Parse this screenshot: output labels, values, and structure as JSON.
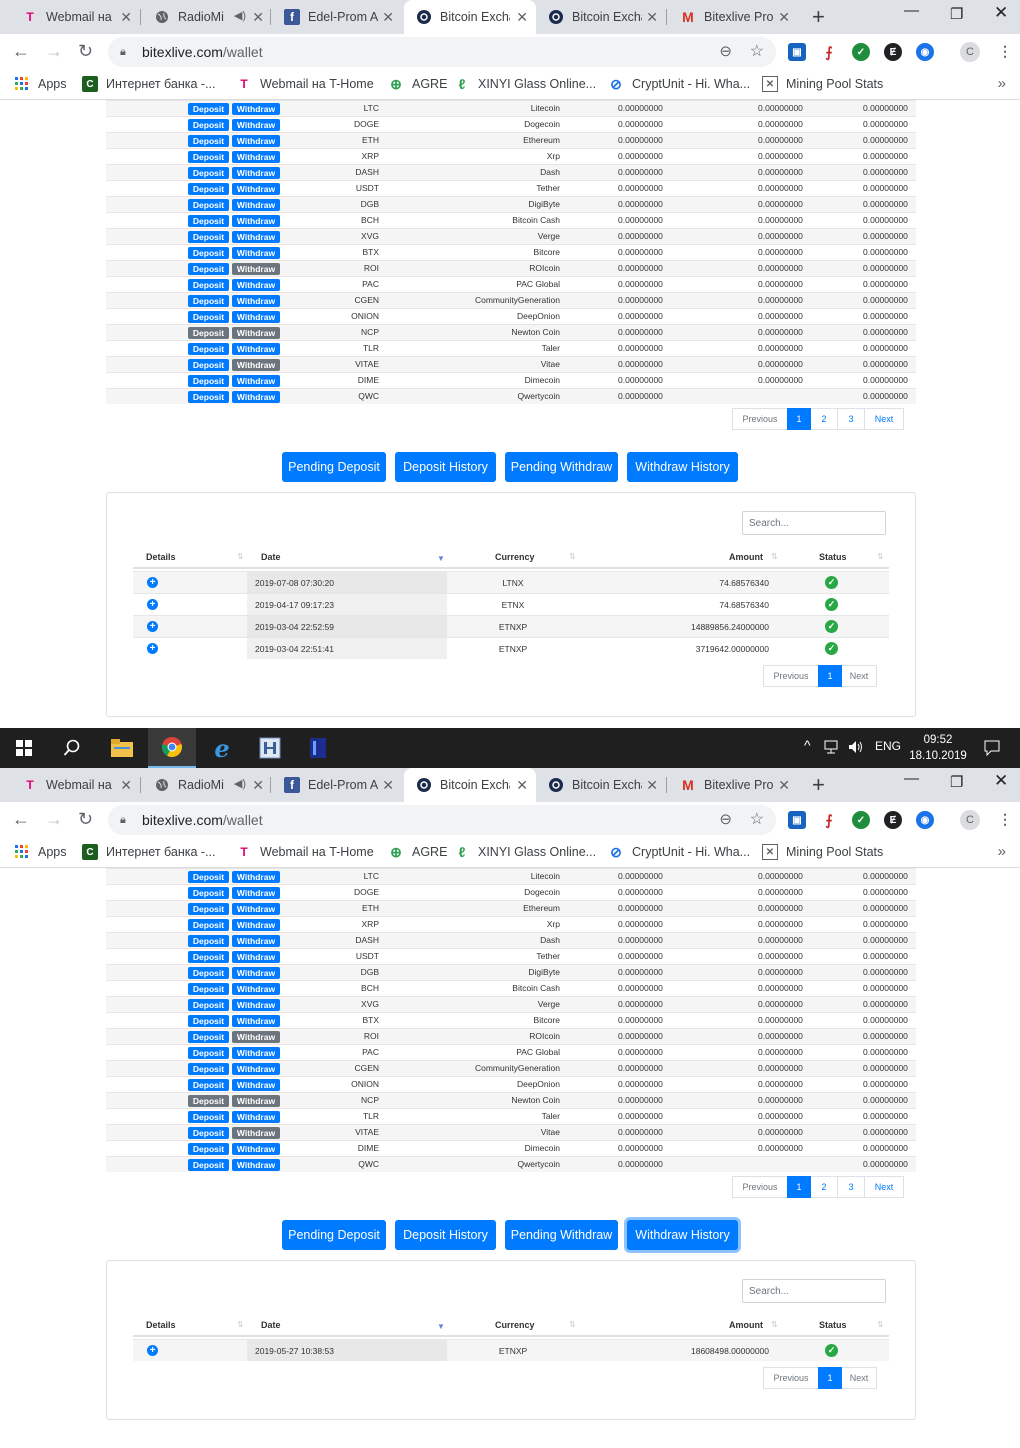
{
  "browser": {
    "tabs": [
      "Webmail на",
      "RadioMi",
      "Edel-Prom A",
      "Bitcoin Excha",
      "Bitcoin Excha",
      "Bitexlive Pro"
    ],
    "tab_icons": [
      "t-home-icon",
      "globe-icon",
      "facebook-icon",
      "bitexlive-icon",
      "bitexlive-icon",
      "gmail-icon"
    ],
    "active_tab": 3,
    "url_host": "bitexlive.com",
    "url_path": "/wallet",
    "bookmarks": [
      "Apps",
      "Интернет банка -...",
      "Webmail на T-Home",
      "AGRE",
      "XINYI Glass Online...",
      "CryptUnit - Hi. Wha...",
      "Mining Pool Stats"
    ]
  },
  "wallet": {
    "deposit_label": "Deposit",
    "withdraw_label": "Withdraw",
    "rows": [
      {
        "symbol": "LTC",
        "name": "Litecoin",
        "available": "0.00000000",
        "on_hold": "0.00000000",
        "total": "0.00000000",
        "deposit_enabled": true,
        "withdraw_enabled": true
      },
      {
        "symbol": "DOGE",
        "name": "Dogecoin",
        "available": "0.00000000",
        "on_hold": "0.00000000",
        "total": "0.00000000",
        "deposit_enabled": true,
        "withdraw_enabled": true
      },
      {
        "symbol": "ETH",
        "name": "Ethereum",
        "available": "0.00000000",
        "on_hold": "0.00000000",
        "total": "0.00000000",
        "deposit_enabled": true,
        "withdraw_enabled": true
      },
      {
        "symbol": "XRP",
        "name": "Xrp",
        "available": "0.00000000",
        "on_hold": "0.00000000",
        "total": "0.00000000",
        "deposit_enabled": true,
        "withdraw_enabled": true
      },
      {
        "symbol": "DASH",
        "name": "Dash",
        "available": "0.00000000",
        "on_hold": "0.00000000",
        "total": "0.00000000",
        "deposit_enabled": true,
        "withdraw_enabled": true
      },
      {
        "symbol": "USDT",
        "name": "Tether",
        "available": "0.00000000",
        "on_hold": "0.00000000",
        "total": "0.00000000",
        "deposit_enabled": true,
        "withdraw_enabled": true
      },
      {
        "symbol": "DGB",
        "name": "DigiByte",
        "available": "0.00000000",
        "on_hold": "0.00000000",
        "total": "0.00000000",
        "deposit_enabled": true,
        "withdraw_enabled": true
      },
      {
        "symbol": "BCH",
        "name": "Bitcoin Cash",
        "available": "0.00000000",
        "on_hold": "0.00000000",
        "total": "0.00000000",
        "deposit_enabled": true,
        "withdraw_enabled": true
      },
      {
        "symbol": "XVG",
        "name": "Verge",
        "available": "0.00000000",
        "on_hold": "0.00000000",
        "total": "0.00000000",
        "deposit_enabled": true,
        "withdraw_enabled": true
      },
      {
        "symbol": "BTX",
        "name": "Bitcore",
        "available": "0.00000000",
        "on_hold": "0.00000000",
        "total": "0.00000000",
        "deposit_enabled": true,
        "withdraw_enabled": true
      },
      {
        "symbol": "ROI",
        "name": "ROIcoin",
        "available": "0.00000000",
        "on_hold": "0.00000000",
        "total": "0.00000000",
        "deposit_enabled": true,
        "withdraw_enabled": false
      },
      {
        "symbol": "PAC",
        "name": "PAC Global",
        "available": "0.00000000",
        "on_hold": "0.00000000",
        "total": "0.00000000",
        "deposit_enabled": true,
        "withdraw_enabled": true
      },
      {
        "symbol": "CGEN",
        "name": "CommunityGeneration",
        "available": "0.00000000",
        "on_hold": "0.00000000",
        "total": "0.00000000",
        "deposit_enabled": true,
        "withdraw_enabled": true
      },
      {
        "symbol": "ONION",
        "name": "DeepOnion",
        "available": "0.00000000",
        "on_hold": "0.00000000",
        "total": "0.00000000",
        "deposit_enabled": true,
        "withdraw_enabled": true
      },
      {
        "symbol": "NCP",
        "name": "Newton Coin",
        "available": "0.00000000",
        "on_hold": "0.00000000",
        "total": "0.00000000",
        "deposit_enabled": false,
        "withdraw_enabled": false
      },
      {
        "symbol": "TLR",
        "name": "Taler",
        "available": "0.00000000",
        "on_hold": "0.00000000",
        "total": "0.00000000",
        "deposit_enabled": true,
        "withdraw_enabled": true
      },
      {
        "symbol": "VITAE",
        "name": "Vitae",
        "available": "0.00000000",
        "on_hold": "0.00000000",
        "total": "0.00000000",
        "deposit_enabled": true,
        "withdraw_enabled": false
      },
      {
        "symbol": "DIME",
        "name": "Dimecoin",
        "available": "0.00000000",
        "on_hold": "0.00000000",
        "total": "0.00000000",
        "deposit_enabled": true,
        "withdraw_enabled": true
      },
      {
        "symbol": "QWC",
        "name": "Qwertycoin",
        "available": "0.00000000",
        "on_hold": "",
        "total": "0.00000000",
        "deposit_enabled": true,
        "withdraw_enabled": true
      }
    ],
    "pagination": [
      "Previous",
      "1",
      "2",
      "3",
      "Next"
    ]
  },
  "history_tabs": [
    "Pending Deposit",
    "Deposit History",
    "Pending Withdraw",
    "Withdraw History"
  ],
  "history_table": {
    "search_placeholder": "Search...",
    "columns": [
      "Details",
      "Date",
      "Currency",
      "Amount",
      "Status"
    ],
    "pagination": [
      "Previous",
      "1",
      "Next"
    ]
  },
  "screenshot1": {
    "active_history_tab": "Deposit History",
    "rows": [
      {
        "date": "2019-07-08 07:30:20",
        "currency": "LTNX",
        "amount": "74.68576340"
      },
      {
        "date": "2019-04-17 09:17:23",
        "currency": "ETNX",
        "amount": "74.68576340"
      },
      {
        "date": "2019-03-04 22:52:59",
        "currency": "ETNXP",
        "amount": "14889856.24000000"
      },
      {
        "date": "2019-03-04 22:51:41",
        "currency": "ETNXP",
        "amount": "3719642.00000000"
      }
    ]
  },
  "screenshot2": {
    "active_history_tab": "Withdraw History",
    "rows": [
      {
        "date": "2019-05-27 10:38:53",
        "currency": "ETNXP",
        "amount": "18608498.00000000"
      }
    ]
  },
  "taskbar": {
    "apps": [
      "start-icon",
      "search-icon",
      "file-explorer-icon",
      "chrome-icon",
      "edge-icon",
      "app-icon",
      "app-icon"
    ],
    "language": "ENG",
    "time": "09:52",
    "date": "18.10.2019"
  },
  "colors": {
    "primary": "#007bff",
    "disabled": "#6c757d",
    "success": "#28a745",
    "taskbar": "#1f1f1f"
  }
}
